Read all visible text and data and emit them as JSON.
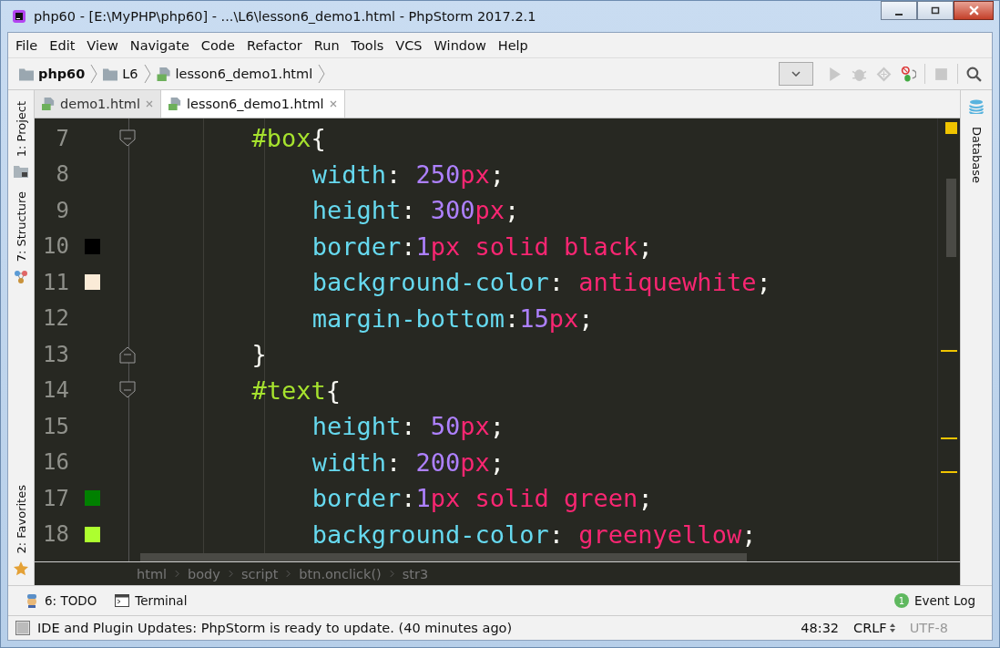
{
  "window": {
    "title": "php60 - [E:\\MyPHP\\php60] - ...\\L6\\lesson6_demo1.html - PhpStorm 2017.2.1"
  },
  "menu": [
    "File",
    "Edit",
    "View",
    "Navigate",
    "Code",
    "Refactor",
    "Run",
    "Tools",
    "VCS",
    "Window",
    "Help"
  ],
  "navbar": {
    "crumbs": [
      {
        "label": "php60",
        "kind": "project"
      },
      {
        "label": "L6",
        "kind": "folder"
      },
      {
        "label": "lesson6_demo1.html",
        "kind": "file"
      }
    ]
  },
  "tabs": [
    {
      "label": "demo1.html",
      "selected": false
    },
    {
      "label": "lesson6_demo1.html",
      "selected": true
    }
  ],
  "left_tools": [
    "1: Project",
    "7: Structure",
    "2: Favorites"
  ],
  "right_tools": [
    "Database"
  ],
  "editor": {
    "lines": [
      {
        "number": "7",
        "kind": "selector",
        "fold": true,
        "tokens": [
          {
            "t": "#box",
            "kind": "sel"
          },
          {
            "t": "{",
            "kind": "p"
          }
        ]
      },
      {
        "number": "8",
        "kind": "declaration",
        "fold": false,
        "tokens": [
          {
            "t": "width",
            "kind": "prop"
          },
          {
            "t": ": ",
            "kind": "p"
          },
          {
            "t": "250",
            "kind": "num"
          },
          {
            "t": "px",
            "kind": "val"
          },
          {
            "t": ";",
            "kind": "p"
          }
        ]
      },
      {
        "number": "9",
        "kind": "declaration",
        "fold": false,
        "tokens": [
          {
            "t": "height",
            "kind": "prop"
          },
          {
            "t": ": ",
            "kind": "p"
          },
          {
            "t": "300",
            "kind": "num"
          },
          {
            "t": "px",
            "kind": "val"
          },
          {
            "t": ";",
            "kind": "p"
          }
        ]
      },
      {
        "number": "10",
        "kind": "declaration",
        "fold": false,
        "color": "#000000",
        "tokens": [
          {
            "t": "border",
            "kind": "prop"
          },
          {
            "t": ":",
            "kind": "p"
          },
          {
            "t": "1",
            "kind": "num"
          },
          {
            "t": "px solid black",
            "kind": "val"
          },
          {
            "t": ";",
            "kind": "p"
          }
        ]
      },
      {
        "number": "11",
        "kind": "declaration",
        "fold": false,
        "color": "#faebd7",
        "tokens": [
          {
            "t": "background-color",
            "kind": "prop"
          },
          {
            "t": ": ",
            "kind": "p"
          },
          {
            "t": "antiquewhite",
            "kind": "val"
          },
          {
            "t": ";",
            "kind": "p"
          }
        ]
      },
      {
        "number": "12",
        "kind": "declaration",
        "fold": false,
        "tokens": [
          {
            "t": "margin-bottom",
            "kind": "prop"
          },
          {
            "t": ":",
            "kind": "p"
          },
          {
            "t": "15",
            "kind": "num"
          },
          {
            "t": "px",
            "kind": "val"
          },
          {
            "t": ";",
            "kind": "p"
          }
        ]
      },
      {
        "number": "13",
        "kind": "close",
        "fold": true,
        "tokens": [
          {
            "t": "}",
            "kind": "p"
          }
        ]
      },
      {
        "number": "14",
        "kind": "selector",
        "fold": true,
        "tokens": [
          {
            "t": "#text",
            "kind": "sel"
          },
          {
            "t": "{",
            "kind": "p"
          }
        ]
      },
      {
        "number": "15",
        "kind": "declaration",
        "fold": false,
        "tokens": [
          {
            "t": "height",
            "kind": "prop"
          },
          {
            "t": ": ",
            "kind": "p"
          },
          {
            "t": "50",
            "kind": "num"
          },
          {
            "t": "px",
            "kind": "val"
          },
          {
            "t": ";",
            "kind": "p"
          }
        ]
      },
      {
        "number": "16",
        "kind": "declaration",
        "fold": false,
        "tokens": [
          {
            "t": "width",
            "kind": "prop"
          },
          {
            "t": ": ",
            "kind": "p"
          },
          {
            "t": "200",
            "kind": "num"
          },
          {
            "t": "px",
            "kind": "val"
          },
          {
            "t": ";",
            "kind": "p"
          }
        ]
      },
      {
        "number": "17",
        "kind": "declaration",
        "fold": false,
        "color": "#008000",
        "tokens": [
          {
            "t": "border",
            "kind": "prop"
          },
          {
            "t": ":",
            "kind": "p"
          },
          {
            "t": "1",
            "kind": "num"
          },
          {
            "t": "px solid green",
            "kind": "val"
          },
          {
            "t": ";",
            "kind": "p"
          }
        ]
      },
      {
        "number": "18",
        "kind": "declaration",
        "fold": false,
        "color": "#adff2f",
        "tokens": [
          {
            "t": "background-color",
            "kind": "prop"
          },
          {
            "t": ": ",
            "kind": "p"
          },
          {
            "t": "greenyellow",
            "kind": "val"
          },
          {
            "t": ";",
            "kind": "p"
          }
        ]
      }
    ],
    "breadcrumbs": [
      "html",
      "body",
      "script",
      "btn.onclick()",
      "str3"
    ]
  },
  "tool_windows": [
    {
      "label": "6: TODO",
      "kind": "todo"
    },
    {
      "label": "Terminal",
      "kind": "terminal"
    }
  ],
  "event_log": {
    "count": "1",
    "label": "Event Log"
  },
  "status_bar": {
    "message": "IDE and Plugin Updates: PhpStorm is ready to update. (40 minutes ago)",
    "position": "48:32",
    "line_separator": "CRLF",
    "encoding": "UTF-8"
  }
}
